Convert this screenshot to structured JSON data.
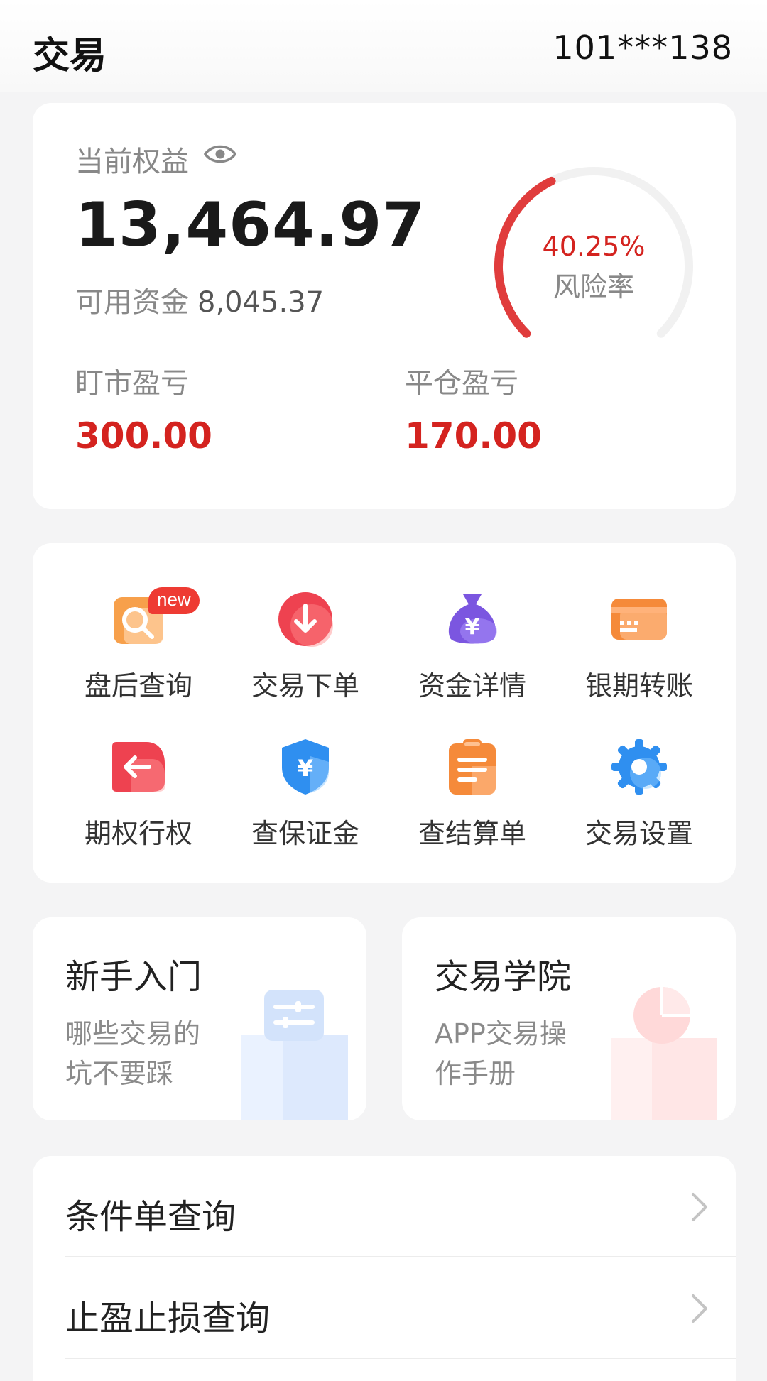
{
  "header": {
    "title": "交易",
    "account_id": "101***138"
  },
  "equity": {
    "label": "当前权益",
    "value": "13,464.97",
    "available_label": "可用资金",
    "available_value": "8,045.37",
    "risk_percent": "40.25%",
    "risk_label": "风险率",
    "risk_ratio": 0.4025,
    "mark_pnl_label": "盯市盈亏",
    "mark_pnl_value": "300.00",
    "close_pnl_label": "平仓盈亏",
    "close_pnl_value": "170.00"
  },
  "menu": {
    "badge": "new",
    "items": [
      {
        "label": "盘后查询",
        "icon": "search-doc-icon"
      },
      {
        "label": "交易下单",
        "icon": "down-arrow-icon"
      },
      {
        "label": "资金详情",
        "icon": "money-bag-icon"
      },
      {
        "label": "银期转账",
        "icon": "bank-card-icon"
      },
      {
        "label": "期权行权",
        "icon": "back-arrow-icon"
      },
      {
        "label": "查保证金",
        "icon": "shield-yen-icon"
      },
      {
        "label": "查结算单",
        "icon": "clipboard-icon"
      },
      {
        "label": "交易设置",
        "icon": "gear-icon"
      }
    ]
  },
  "promos": [
    {
      "title": "新手入门",
      "desc": "哪些交易的坑不要踩"
    },
    {
      "title": "交易学院",
      "desc": "APP交易操作手册"
    }
  ],
  "queries": [
    {
      "label": "条件单查询"
    },
    {
      "label": "止盈止损查询"
    }
  ],
  "colors": {
    "accent_red": "#d4231f",
    "gauge_track": "#f0f0f0",
    "background": "#f4f4f5"
  }
}
